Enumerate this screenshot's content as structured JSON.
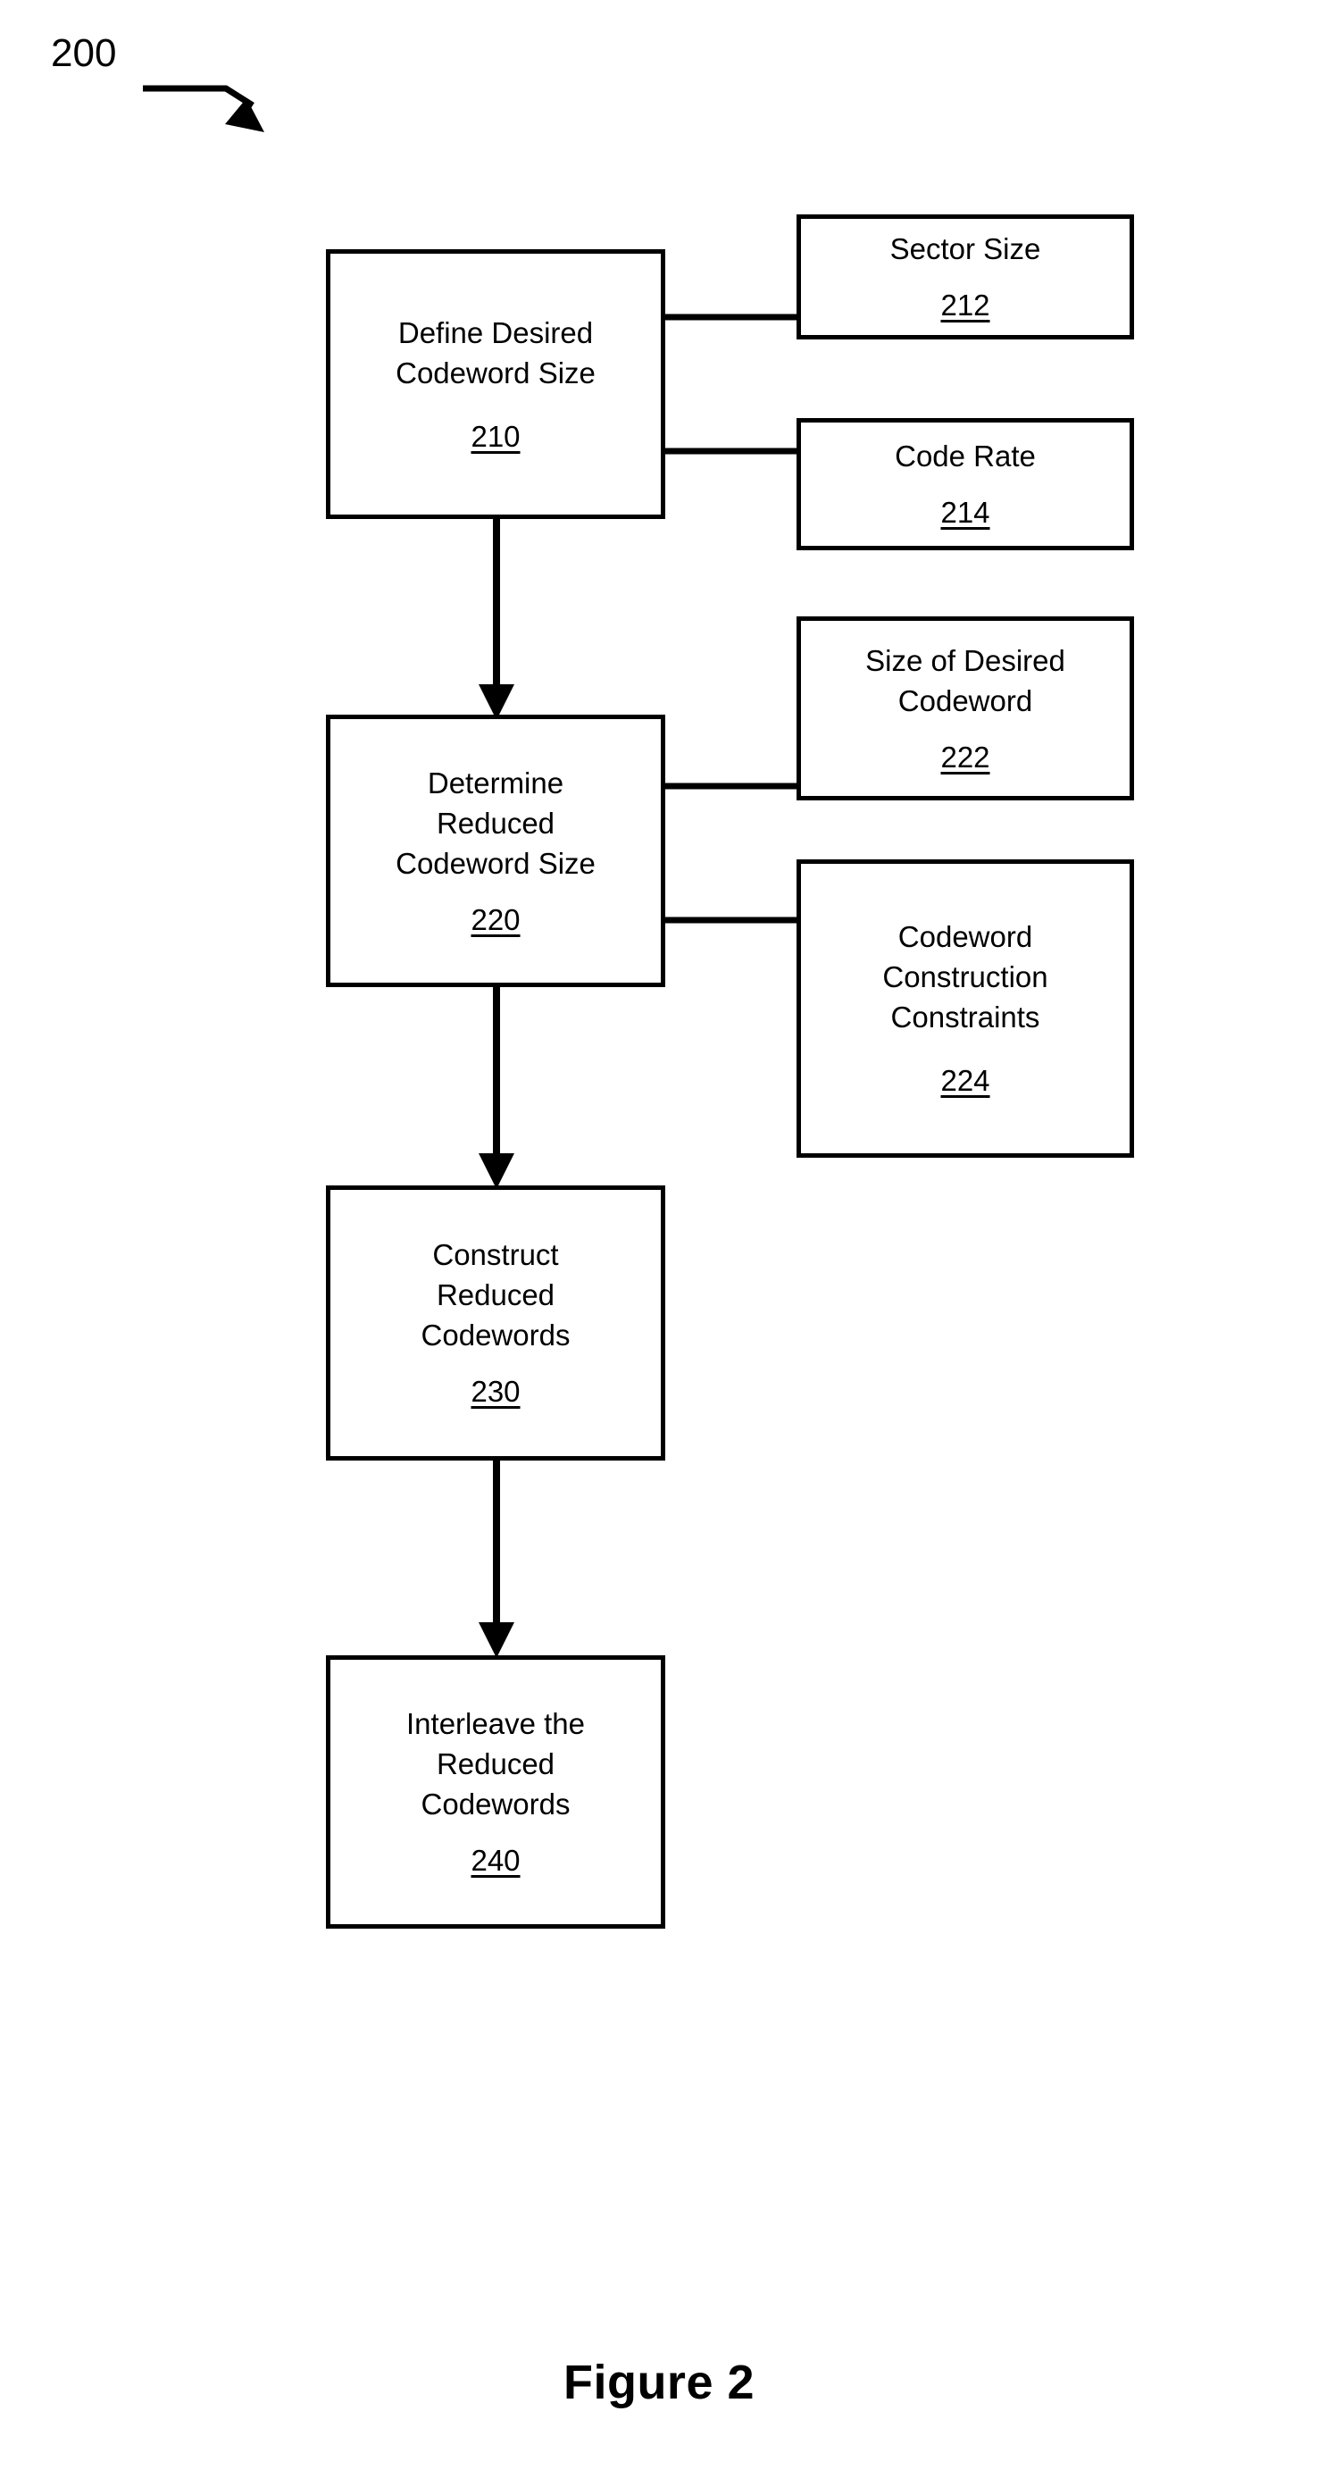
{
  "figure": {
    "reference_numeral": "200",
    "caption": "Figure 2"
  },
  "flow": {
    "steps": [
      {
        "id": "210",
        "label": "Define Desired\nCodeword Size",
        "ref": "210"
      },
      {
        "id": "220",
        "label": "Determine\nReduced\nCodeword Size",
        "ref": "220"
      },
      {
        "id": "230",
        "label": "Construct\nReduced\nCodewords",
        "ref": "230"
      },
      {
        "id": "240",
        "label": "Interleave the\nReduced\nCodewords",
        "ref": "240"
      }
    ],
    "inputs": [
      {
        "id": "212",
        "label": "Sector Size",
        "ref": "212",
        "parent": "210"
      },
      {
        "id": "214",
        "label": "Code Rate",
        "ref": "214",
        "parent": "210"
      },
      {
        "id": "222",
        "label": "Size of Desired\nCodeword",
        "ref": "222",
        "parent": "220"
      },
      {
        "id": "224",
        "label": "Codeword\nConstruction\nConstraints",
        "ref": "224",
        "parent": "220"
      }
    ]
  },
  "colors": {
    "stroke": "#000000",
    "background": "#ffffff",
    "text": "#000000"
  }
}
